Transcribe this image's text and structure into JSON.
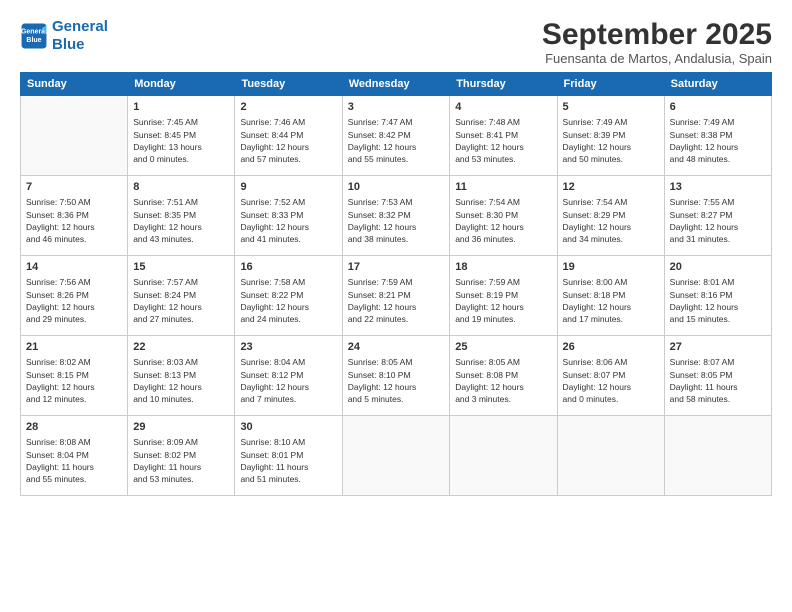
{
  "logo": {
    "line1": "General",
    "line2": "Blue"
  },
  "title": "September 2025",
  "subtitle": "Fuensanta de Martos, Andalusia, Spain",
  "header": {
    "accent_color": "#1a6ab1"
  },
  "days_of_week": [
    "Sunday",
    "Monday",
    "Tuesday",
    "Wednesday",
    "Thursday",
    "Friday",
    "Saturday"
  ],
  "weeks": [
    [
      {
        "num": "",
        "info": ""
      },
      {
        "num": "1",
        "info": "Sunrise: 7:45 AM\nSunset: 8:45 PM\nDaylight: 13 hours\nand 0 minutes."
      },
      {
        "num": "2",
        "info": "Sunrise: 7:46 AM\nSunset: 8:44 PM\nDaylight: 12 hours\nand 57 minutes."
      },
      {
        "num": "3",
        "info": "Sunrise: 7:47 AM\nSunset: 8:42 PM\nDaylight: 12 hours\nand 55 minutes."
      },
      {
        "num": "4",
        "info": "Sunrise: 7:48 AM\nSunset: 8:41 PM\nDaylight: 12 hours\nand 53 minutes."
      },
      {
        "num": "5",
        "info": "Sunrise: 7:49 AM\nSunset: 8:39 PM\nDaylight: 12 hours\nand 50 minutes."
      },
      {
        "num": "6",
        "info": "Sunrise: 7:49 AM\nSunset: 8:38 PM\nDaylight: 12 hours\nand 48 minutes."
      }
    ],
    [
      {
        "num": "7",
        "info": "Sunrise: 7:50 AM\nSunset: 8:36 PM\nDaylight: 12 hours\nand 46 minutes."
      },
      {
        "num": "8",
        "info": "Sunrise: 7:51 AM\nSunset: 8:35 PM\nDaylight: 12 hours\nand 43 minutes."
      },
      {
        "num": "9",
        "info": "Sunrise: 7:52 AM\nSunset: 8:33 PM\nDaylight: 12 hours\nand 41 minutes."
      },
      {
        "num": "10",
        "info": "Sunrise: 7:53 AM\nSunset: 8:32 PM\nDaylight: 12 hours\nand 38 minutes."
      },
      {
        "num": "11",
        "info": "Sunrise: 7:54 AM\nSunset: 8:30 PM\nDaylight: 12 hours\nand 36 minutes."
      },
      {
        "num": "12",
        "info": "Sunrise: 7:54 AM\nSunset: 8:29 PM\nDaylight: 12 hours\nand 34 minutes."
      },
      {
        "num": "13",
        "info": "Sunrise: 7:55 AM\nSunset: 8:27 PM\nDaylight: 12 hours\nand 31 minutes."
      }
    ],
    [
      {
        "num": "14",
        "info": "Sunrise: 7:56 AM\nSunset: 8:26 PM\nDaylight: 12 hours\nand 29 minutes."
      },
      {
        "num": "15",
        "info": "Sunrise: 7:57 AM\nSunset: 8:24 PM\nDaylight: 12 hours\nand 27 minutes."
      },
      {
        "num": "16",
        "info": "Sunrise: 7:58 AM\nSunset: 8:22 PM\nDaylight: 12 hours\nand 24 minutes."
      },
      {
        "num": "17",
        "info": "Sunrise: 7:59 AM\nSunset: 8:21 PM\nDaylight: 12 hours\nand 22 minutes."
      },
      {
        "num": "18",
        "info": "Sunrise: 7:59 AM\nSunset: 8:19 PM\nDaylight: 12 hours\nand 19 minutes."
      },
      {
        "num": "19",
        "info": "Sunrise: 8:00 AM\nSunset: 8:18 PM\nDaylight: 12 hours\nand 17 minutes."
      },
      {
        "num": "20",
        "info": "Sunrise: 8:01 AM\nSunset: 8:16 PM\nDaylight: 12 hours\nand 15 minutes."
      }
    ],
    [
      {
        "num": "21",
        "info": "Sunrise: 8:02 AM\nSunset: 8:15 PM\nDaylight: 12 hours\nand 12 minutes."
      },
      {
        "num": "22",
        "info": "Sunrise: 8:03 AM\nSunset: 8:13 PM\nDaylight: 12 hours\nand 10 minutes."
      },
      {
        "num": "23",
        "info": "Sunrise: 8:04 AM\nSunset: 8:12 PM\nDaylight: 12 hours\nand 7 minutes."
      },
      {
        "num": "24",
        "info": "Sunrise: 8:05 AM\nSunset: 8:10 PM\nDaylight: 12 hours\nand 5 minutes."
      },
      {
        "num": "25",
        "info": "Sunrise: 8:05 AM\nSunset: 8:08 PM\nDaylight: 12 hours\nand 3 minutes."
      },
      {
        "num": "26",
        "info": "Sunrise: 8:06 AM\nSunset: 8:07 PM\nDaylight: 12 hours\nand 0 minutes."
      },
      {
        "num": "27",
        "info": "Sunrise: 8:07 AM\nSunset: 8:05 PM\nDaylight: 11 hours\nand 58 minutes."
      }
    ],
    [
      {
        "num": "28",
        "info": "Sunrise: 8:08 AM\nSunset: 8:04 PM\nDaylight: 11 hours\nand 55 minutes."
      },
      {
        "num": "29",
        "info": "Sunrise: 8:09 AM\nSunset: 8:02 PM\nDaylight: 11 hours\nand 53 minutes."
      },
      {
        "num": "30",
        "info": "Sunrise: 8:10 AM\nSunset: 8:01 PM\nDaylight: 11 hours\nand 51 minutes."
      },
      {
        "num": "",
        "info": ""
      },
      {
        "num": "",
        "info": ""
      },
      {
        "num": "",
        "info": ""
      },
      {
        "num": "",
        "info": ""
      }
    ]
  ]
}
